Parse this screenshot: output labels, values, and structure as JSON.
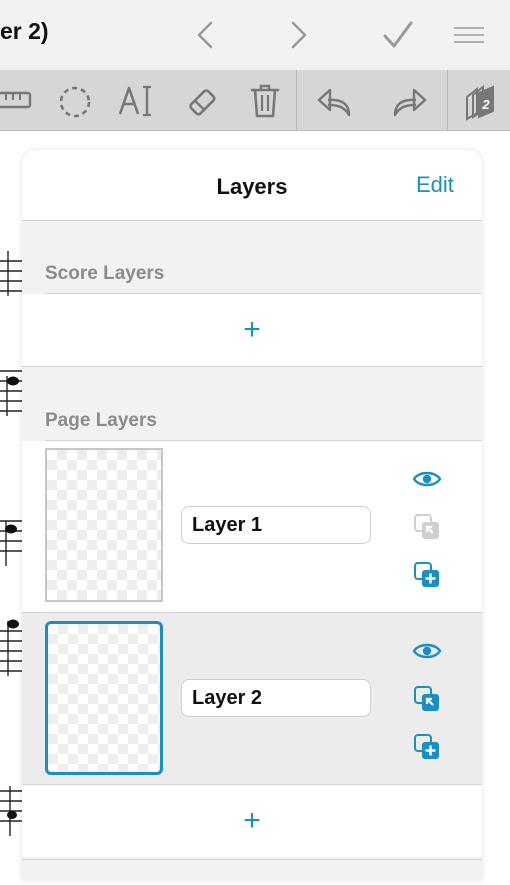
{
  "nav": {
    "title": "er 2)",
    "back_icon": "chevron-left-icon",
    "forward_icon": "chevron-right-icon",
    "done_icon": "checkmark-icon",
    "menu_icon": "hamburger-menu-icon"
  },
  "toolbar": {
    "tools": [
      "ruler-icon",
      "lasso-select-icon",
      "text-tool-icon",
      "eraser-icon",
      "trash-icon",
      "undo-icon",
      "redo-icon",
      "layers-icon"
    ],
    "layers_badge": "2"
  },
  "popover": {
    "title": "Layers",
    "edit_label": "Edit",
    "score_layers_label": "Score Layers",
    "page_layers_label": "Page Layers",
    "add_label": "+",
    "layers": [
      {
        "name": "Layer 1",
        "selected": false,
        "visible": true,
        "move_enabled": false
      },
      {
        "name": "Layer 2",
        "selected": true,
        "visible": true,
        "move_enabled": true
      }
    ]
  },
  "colors": {
    "accent": "#1a8fc3",
    "toolbar_bg": "#d6d6d6",
    "nav_bg": "#f2f2f2",
    "popover_bg": "#f2f2f2",
    "section_label": "#8b8b8b"
  }
}
